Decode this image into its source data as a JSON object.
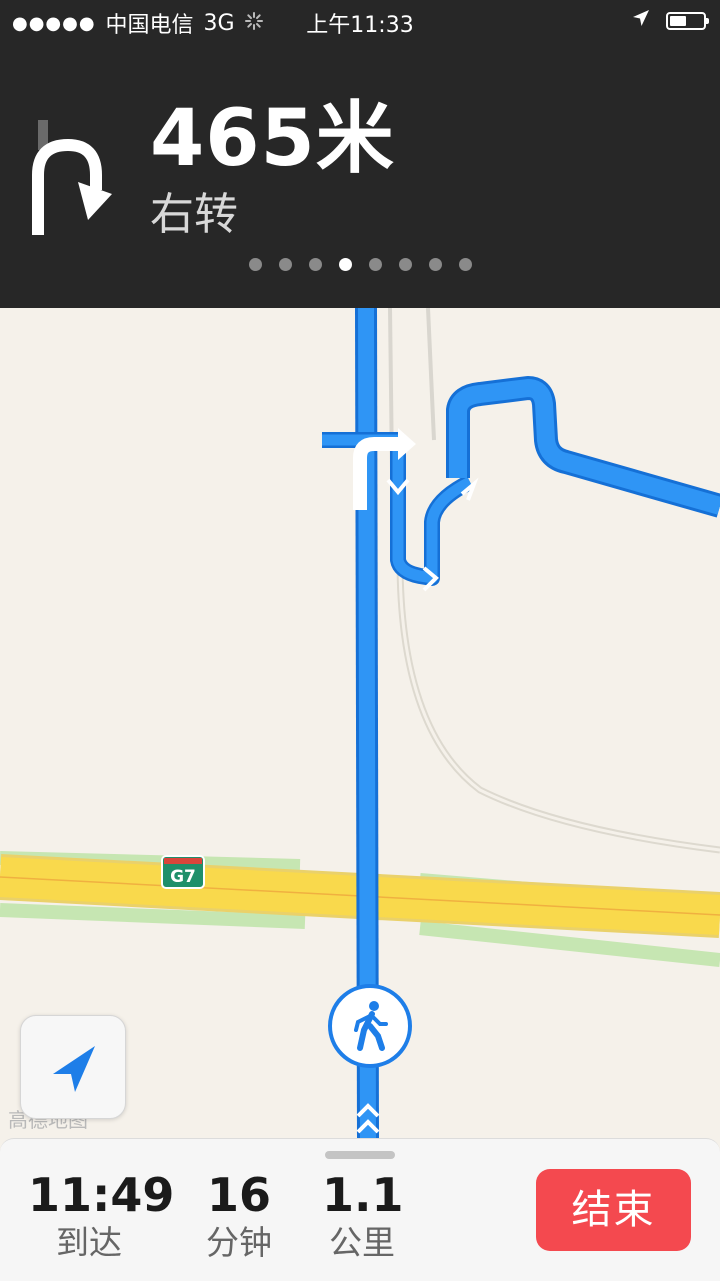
{
  "status_bar": {
    "signal": "●●●●●",
    "carrier": "中国电信",
    "network": "3G",
    "time": "上午11:33",
    "icons": [
      "location-arrow-icon",
      "battery-icon"
    ]
  },
  "navigation": {
    "distance": "465米",
    "instruction": "右转",
    "turn_icon": "turn-right-icon",
    "page_count": 8,
    "active_page": 4
  },
  "map": {
    "watermark": "高德地图",
    "road_label": "G7",
    "colors": {
      "route": "#1e8cf2",
      "highway": "#f9d94c",
      "green": "#c5e6b0",
      "background": "#f5f1ea"
    }
  },
  "trip": {
    "arrival_time": "11:49",
    "arrival_label": "到达",
    "duration": "16",
    "duration_label": "分钟",
    "distance": "1.1",
    "distance_label": "公里",
    "end_label": "结束"
  }
}
